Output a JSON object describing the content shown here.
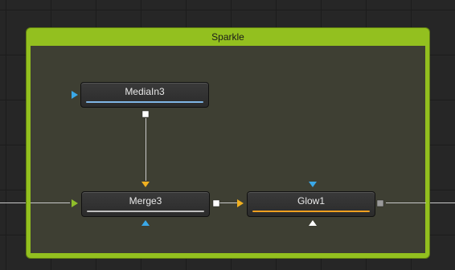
{
  "group": {
    "title": "Sparkle",
    "color": "#93c01f"
  },
  "nodes": {
    "media_in": {
      "label": "MediaIn3",
      "bar_color": "#7fb6e6"
    },
    "merge": {
      "label": "Merge3",
      "bar_color": "#bfbfbf"
    },
    "glow": {
      "label": "Glow1",
      "bar_color": "#f0a020"
    }
  },
  "port_colors": {
    "input_blue": "#3aa8e8",
    "input_yellow": "#f0b020",
    "input_green": "#8fbf2a",
    "output_white": "#ffffff",
    "output_gray": "#9a9a9a"
  }
}
